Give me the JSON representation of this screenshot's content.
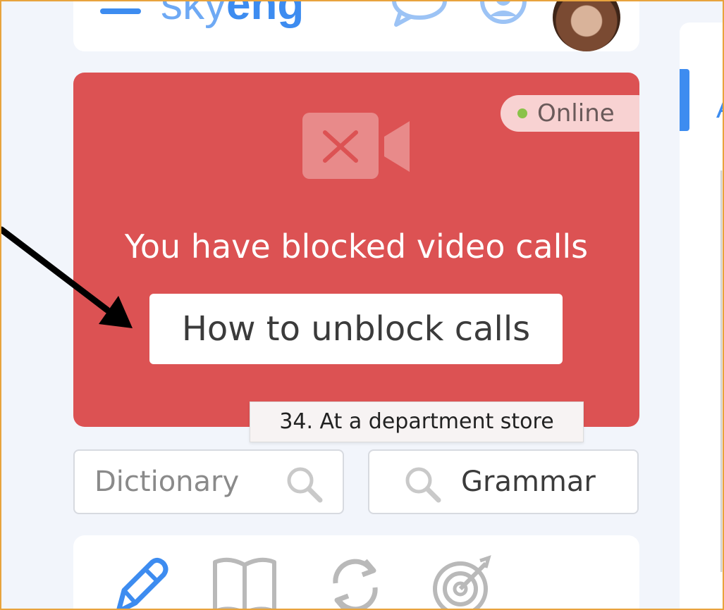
{
  "header": {
    "logo_light": "sky",
    "logo_bold": "eng"
  },
  "video_panel": {
    "status": "Online",
    "message": "You have blocked video calls",
    "action_label": "How to unblock calls"
  },
  "tooltip": {
    "text": "34. At a department store"
  },
  "search": {
    "dictionary_label": "Dictionary",
    "grammar_label": "Grammar"
  },
  "right_panel": {
    "partial_letter": "A"
  },
  "colors": {
    "brand_blue": "#3d8cf0",
    "alert_red": "#dc5253",
    "online_green": "#8ac249",
    "frame_orange": "#e8a33d"
  },
  "icons": [
    "menu-icon",
    "chat-icon",
    "support-icon",
    "video-camera-blocked-icon",
    "search-icon",
    "pencil-icon",
    "book-icon",
    "refresh-icon",
    "target-icon",
    "arrow-annotation"
  ]
}
